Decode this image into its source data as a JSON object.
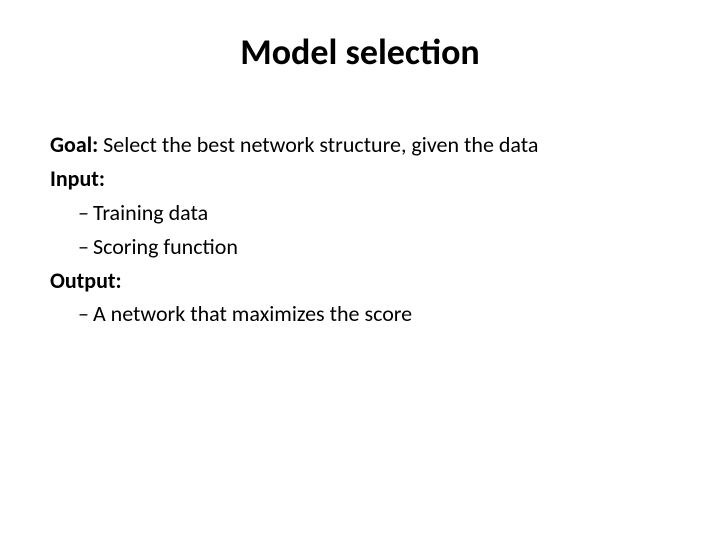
{
  "title": "Model selection",
  "goal": {
    "label": "Goal:",
    "text": " Select the best network structure, given the data"
  },
  "input": {
    "label": "Input:",
    "items": [
      "Training data",
      "Scoring function"
    ]
  },
  "output": {
    "label": "Output:",
    "items": [
      "A network that maximizes the score"
    ]
  }
}
